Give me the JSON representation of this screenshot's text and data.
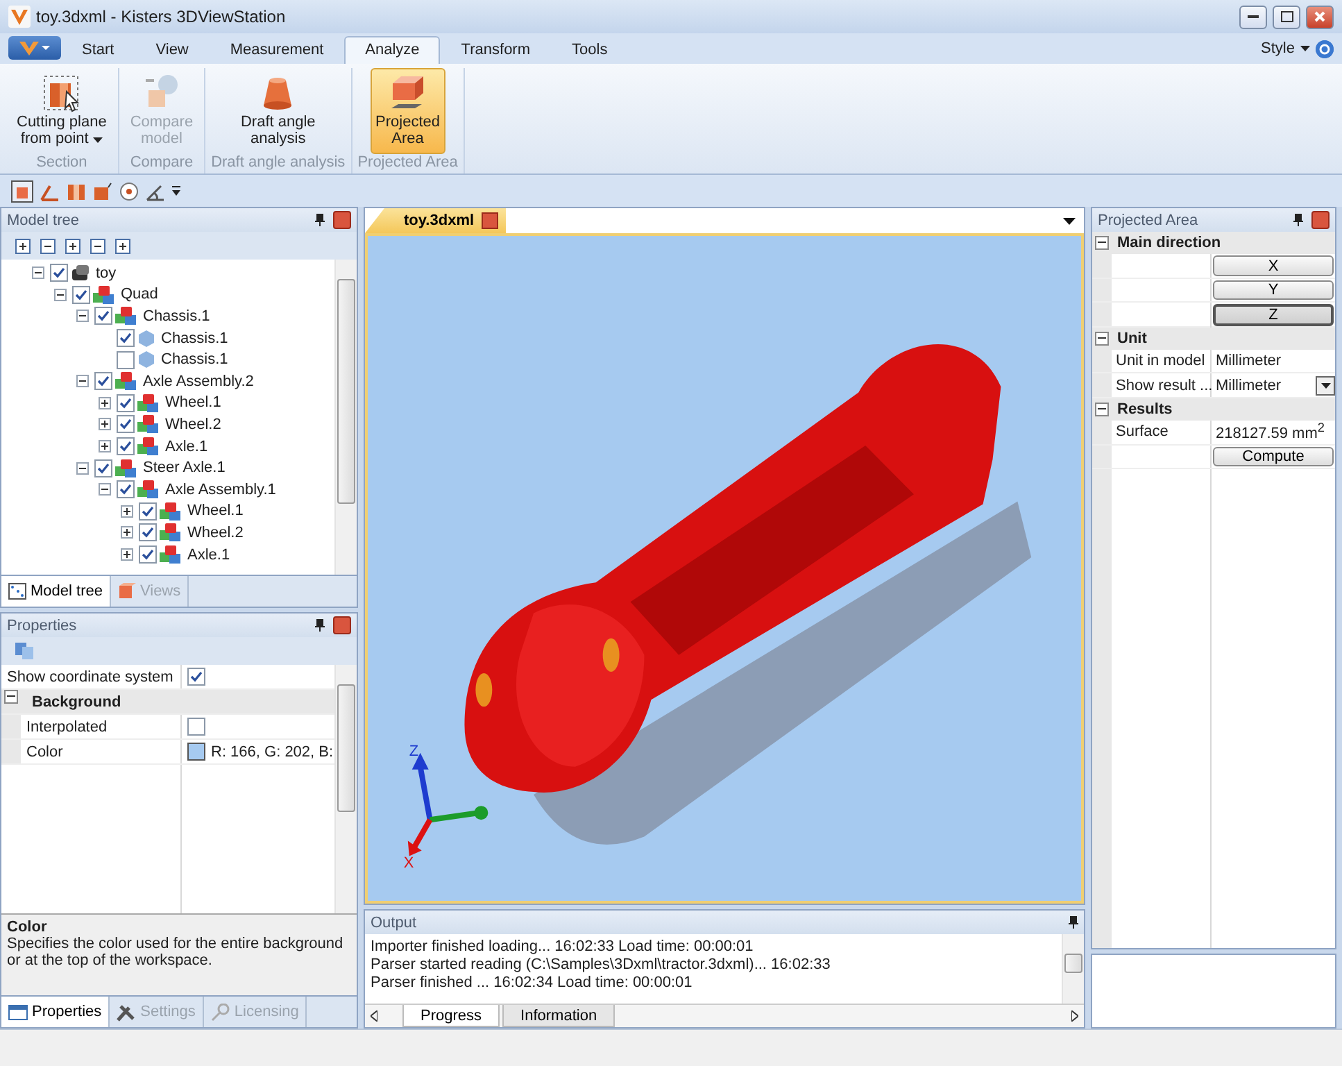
{
  "window": {
    "title": "toy.3dxml - Kisters 3DViewStation"
  },
  "ribbon": {
    "tabs": [
      {
        "label": "Start",
        "selected": false
      },
      {
        "label": "View",
        "selected": false
      },
      {
        "label": "Measurement",
        "selected": false
      },
      {
        "label": "Analyze",
        "selected": true
      },
      {
        "label": "Transform",
        "selected": false
      },
      {
        "label": "Tools",
        "selected": false
      }
    ],
    "style_menu": "Style",
    "groups": [
      {
        "label": "Section",
        "buttons": [
          {
            "lines": [
              "Cutting plane",
              "from point"
            ],
            "kind": "cutting",
            "dropdown": true,
            "disabled": false,
            "selected": false
          }
        ]
      },
      {
        "label": "Compare",
        "buttons": [
          {
            "lines": [
              "Compare",
              "model"
            ],
            "kind": "compare",
            "dropdown": false,
            "disabled": true,
            "selected": false
          }
        ]
      },
      {
        "label": "Draft angle analysis",
        "buttons": [
          {
            "lines": [
              "Draft angle",
              "analysis"
            ],
            "kind": "draft",
            "dropdown": false,
            "disabled": false,
            "selected": false
          }
        ]
      },
      {
        "label": "Projected Area",
        "buttons": [
          {
            "lines": [
              "Projected",
              "Area"
            ],
            "kind": "projected",
            "dropdown": false,
            "disabled": false,
            "selected": true
          }
        ]
      }
    ]
  },
  "model_tree": {
    "title": "Model tree",
    "nodes": [
      {
        "label": "toy",
        "kind": "root",
        "checked": true,
        "expanded": true,
        "children": [
          {
            "label": "Quad",
            "kind": "assembly",
            "checked": true,
            "expanded": true,
            "children": [
              {
                "label": "Chassis.1",
                "kind": "assembly",
                "checked": true,
                "expanded": true,
                "children": [
                  {
                    "label": "Chassis.1",
                    "kind": "part",
                    "checked": true
                  },
                  {
                    "label": "Chassis.1",
                    "kind": "part",
                    "checked": false
                  }
                ]
              },
              {
                "label": "Axle Assembly.2",
                "kind": "assembly",
                "checked": true,
                "expanded": true,
                "children": [
                  {
                    "label": "Wheel.1",
                    "kind": "assembly",
                    "checked": true,
                    "expanded": false
                  },
                  {
                    "label": "Wheel.2",
                    "kind": "assembly",
                    "checked": true,
                    "expanded": false
                  },
                  {
                    "label": "Axle.1",
                    "kind": "assembly",
                    "checked": true,
                    "expanded": false
                  }
                ]
              },
              {
                "label": "Steer Axle.1",
                "kind": "assembly",
                "checked": true,
                "expanded": true,
                "children": [
                  {
                    "label": "Axle Assembly.1",
                    "kind": "assembly",
                    "checked": true,
                    "expanded": true,
                    "children": [
                      {
                        "label": "Wheel.1",
                        "kind": "assembly",
                        "checked": true,
                        "expanded": false
                      },
                      {
                        "label": "Wheel.2",
                        "kind": "assembly",
                        "checked": true,
                        "expanded": false
                      },
                      {
                        "label": "Axle.1",
                        "kind": "assembly",
                        "checked": true,
                        "expanded": false
                      }
                    ]
                  }
                ]
              }
            ]
          }
        ]
      }
    ],
    "tabs": [
      {
        "label": "Model tree",
        "selected": true,
        "disabled": false
      },
      {
        "label": "Views",
        "selected": false,
        "disabled": true
      }
    ]
  },
  "properties": {
    "title": "Properties",
    "rows": [
      {
        "kind": "check",
        "name": "Show coordinate system",
        "checked": true
      },
      {
        "kind": "category",
        "name": "Background",
        "expanded": true,
        "children": [
          {
            "kind": "check",
            "name": "Interpolated",
            "checked": false
          },
          {
            "kind": "color",
            "name": "Color",
            "value": "R: 166, G: 202, B:",
            "color": "#a6caf0"
          }
        ]
      }
    ],
    "description": {
      "title": "Color",
      "text": "Specifies the color used for the entire background or at the top of the workspace."
    },
    "tabs": [
      {
        "label": "Properties",
        "selected": true,
        "disabled": false
      },
      {
        "label": "Settings",
        "selected": false,
        "disabled": true
      },
      {
        "label": "Licensing",
        "selected": false,
        "disabled": true
      }
    ]
  },
  "document": {
    "tabs": [
      {
        "label": "toy.3dxml",
        "selected": true
      }
    ],
    "axes": [
      {
        "label": "Z"
      },
      {
        "label": "X"
      }
    ]
  },
  "output": {
    "title": "Output",
    "lines": [
      "Importer finished loading... 16:02:33 Load time: 00:00:01",
      "Parser started reading (C:\\Samples\\3Dxml\\tractor.3dxml)... 16:02:33",
      "Parser finished ... 16:02:34 Load time: 00:00:01"
    ],
    "tabs": [
      {
        "label": "Progress",
        "selected": true
      },
      {
        "label": "Information",
        "selected": false
      }
    ]
  },
  "projected_area": {
    "title": "Projected Area",
    "categories": [
      {
        "label": "Main direction",
        "expanded": true,
        "rows": [
          {
            "kind": "button",
            "label": "X",
            "selected": false
          },
          {
            "kind": "button",
            "label": "Y",
            "selected": false
          },
          {
            "kind": "button",
            "label": "Z",
            "selected": true
          }
        ]
      },
      {
        "label": "Unit",
        "expanded": true,
        "rows": [
          {
            "kind": "text",
            "name": "Unit in model",
            "value": "Millimeter"
          },
          {
            "kind": "dropdown",
            "name": "Show result ...",
            "value": "Millimeter"
          }
        ]
      },
      {
        "label": "Results",
        "expanded": true,
        "rows": [
          {
            "kind": "text",
            "name": "Surface",
            "value": "218127.59 mm$^{2}$"
          },
          {
            "kind": "action",
            "label": "Compute"
          }
        ]
      }
    ]
  }
}
